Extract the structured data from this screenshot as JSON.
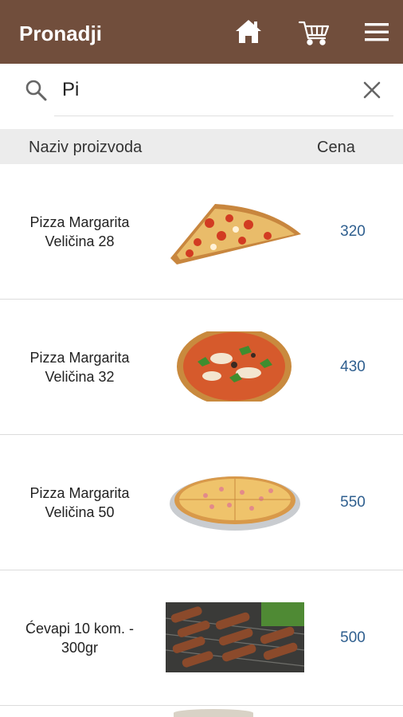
{
  "app": {
    "title": "Pronadji",
    "icons": [
      "home-icon",
      "cart-icon",
      "menu-icon"
    ]
  },
  "search": {
    "value": "Pi",
    "placeholder": ""
  },
  "table": {
    "headers": {
      "name": "Naziv proizvoda",
      "price": "Cena"
    },
    "rows": [
      {
        "name": "Pizza Margarita Veličina 28",
        "price": "320",
        "image": "pizza-slice"
      },
      {
        "name": "Pizza Margarita Veličina 32",
        "price": "430",
        "image": "pizza-whole-basil"
      },
      {
        "name": "Pizza Margarita Veličina 50",
        "price": "550",
        "image": "pizza-on-tray"
      },
      {
        "name": "Ćevapi  10 kom. - 300gr",
        "price": "500",
        "image": "cevapi-grill"
      }
    ]
  },
  "colors": {
    "appbar": "#714e3c",
    "price_text": "#2f5f8f",
    "header_bg": "#ececec"
  }
}
